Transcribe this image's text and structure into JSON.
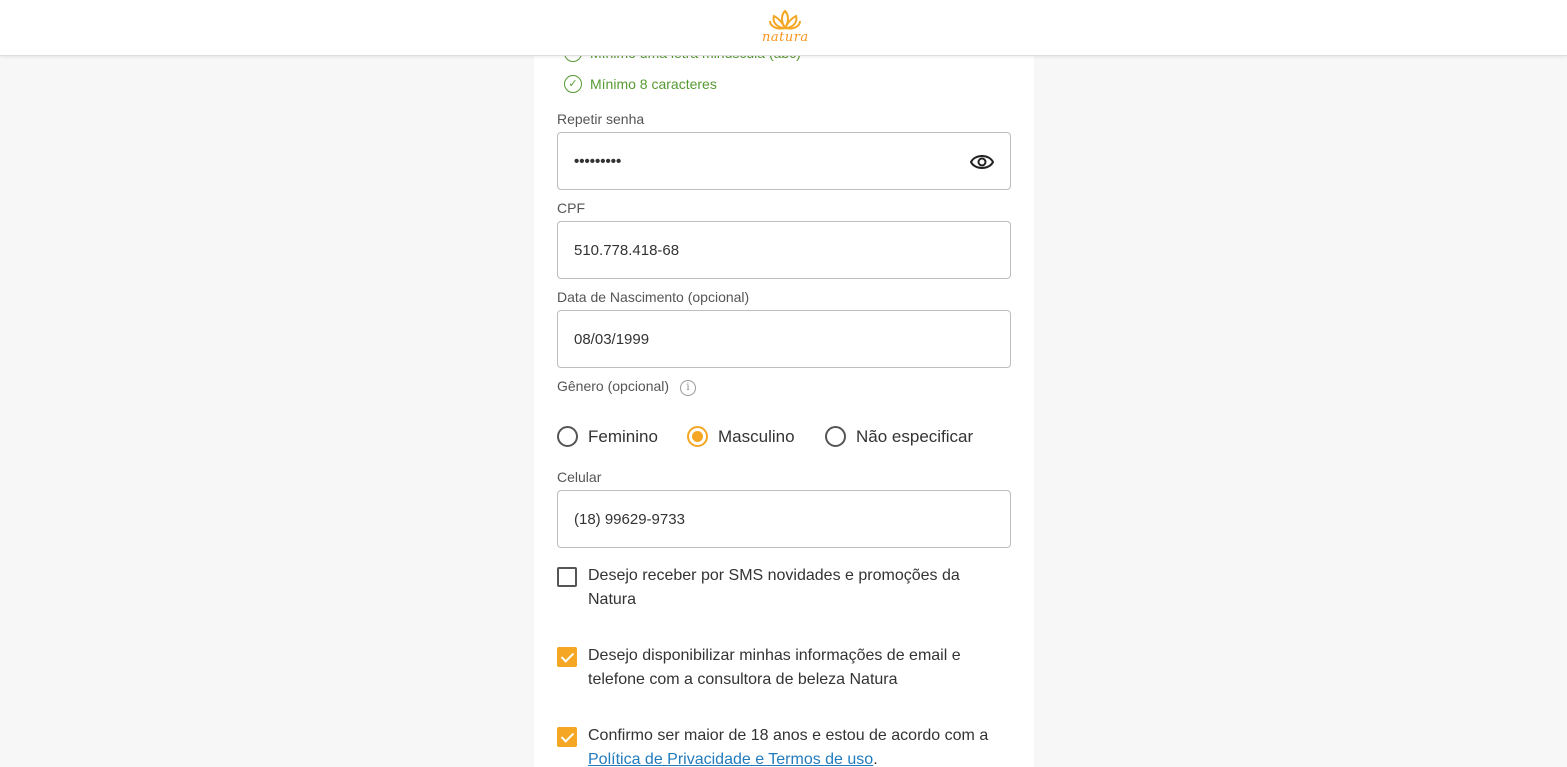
{
  "header": {
    "brand": "natura",
    "logo_icon": "natura-flower-icon"
  },
  "password_rules": [
    {
      "label": "Mínimo uma letra minúscula (abc)",
      "met": true
    },
    {
      "label": "Mínimo 8 caracteres",
      "met": true
    }
  ],
  "form": {
    "repeat_password": {
      "label": "Repetir senha",
      "value": "•••••••••"
    },
    "cpf": {
      "label": "CPF",
      "value": "510.778.418-68"
    },
    "birth_date": {
      "label": "Data de Nascimento (opcional)",
      "value": "08/03/1999"
    },
    "gender": {
      "label": "Gênero (opcional)",
      "options": [
        "Feminino",
        "Masculino",
        "Não especificar"
      ],
      "selected": "Masculino"
    },
    "phone": {
      "label": "Celular",
      "value": "(18) 99629-9733"
    }
  },
  "consents": {
    "sms": {
      "text": "Desejo receber por SMS novidades e promoções da Natura",
      "checked": false
    },
    "share": {
      "text": "Desejo disponibilizar minhas informações de email e telefone com a consultora de beleza Natura",
      "checked": true
    },
    "terms": {
      "text_before": "Confirmo ser maior de 18 anos e estou de acordo com a ",
      "link_text": "Política de Privacidade e Termos de uso",
      "text_after": ".",
      "checked": true
    }
  },
  "colors": {
    "accent": "#f5a623",
    "success": "#569a32",
    "link": "#227bbd",
    "brand_orange": "#f7941d"
  }
}
